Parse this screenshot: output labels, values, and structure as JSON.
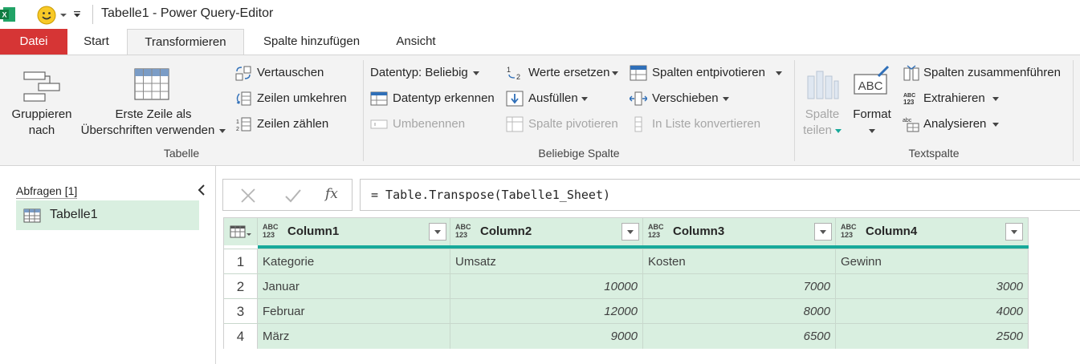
{
  "window": {
    "title": "Tabelle1 - Power Query-Editor"
  },
  "tabs": [
    {
      "label": "Datei"
    },
    {
      "label": "Start"
    },
    {
      "label": "Transformieren"
    },
    {
      "label": "Spalte hinzufügen"
    },
    {
      "label": "Ansicht"
    }
  ],
  "ribbon": {
    "tabelle": {
      "group_label": "Tabelle",
      "gruppieren_line1": "Gruppieren",
      "gruppieren_line2": "nach",
      "erste_zeile_line1": "Erste Zeile als",
      "erste_zeile_line2": "Überschriften verwenden",
      "vertauschen": "Vertauschen",
      "zeilen_umkehren": "Zeilen umkehren",
      "zeilen_zaehlen": "Zeilen zählen"
    },
    "beliebige_spalte": {
      "group_label": "Beliebige Spalte",
      "datentyp": "Datentyp: Beliebig",
      "datentyp_erkennen": "Datentyp erkennen",
      "umbenennen": "Umbenennen",
      "werte_ersetzen": "Werte ersetzen",
      "ausfuellen": "Ausfüllen",
      "spalte_pivotieren": "Spalte pivotieren",
      "spalten_entpivotieren": "Spalten entpivotieren",
      "verschieben": "Verschieben",
      "in_liste_konvertieren": "In Liste konvertieren"
    },
    "textspalte": {
      "group_label": "Textspalte",
      "spalte_teilen_line1": "Spalte",
      "spalte_teilen_line2": "teilen",
      "format": "Format",
      "spalten_zusammenfuehren": "Spalten zusammenführen",
      "extrahieren": "Extrahieren",
      "analysieren": "Analysieren"
    }
  },
  "queries_pane": {
    "title": "Abfragen [1]",
    "items": [
      {
        "label": "Tabelle1"
      }
    ]
  },
  "formula_bar": {
    "fx": "fx",
    "formula": "= Table.Transpose(Tabelle1_Sheet)"
  },
  "grid": {
    "type_badge_top": "ABC",
    "type_badge_bottom": "123",
    "columns": [
      "Column1",
      "Column2",
      "Column3",
      "Column4"
    ],
    "rows": [
      {
        "num": "1",
        "cells": [
          "Kategorie",
          "Umsatz",
          "Kosten",
          "Gewinn"
        ]
      },
      {
        "num": "2",
        "cells": [
          "Januar",
          "10000",
          "7000",
          "3000"
        ]
      },
      {
        "num": "3",
        "cells": [
          "Februar",
          "12000",
          "8000",
          "4000"
        ]
      },
      {
        "num": "4",
        "cells": [
          "März",
          "9000",
          "6500",
          "2500"
        ]
      }
    ]
  },
  "colors": {
    "file_tab": "#d63535",
    "ribbon_bg": "#f3f3f3",
    "grid_fill": "#d9efe0",
    "header_accent": "#18a99a"
  }
}
